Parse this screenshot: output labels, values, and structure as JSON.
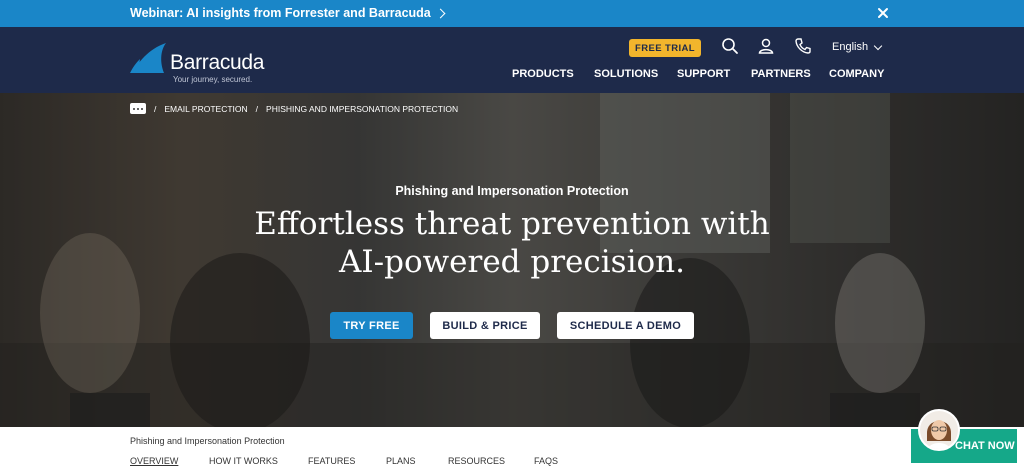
{
  "banner": {
    "text": "Webinar: AI insights from Forrester and Barracuda",
    "close_icon": "close-icon"
  },
  "header": {
    "logo": {
      "name": "Barracuda",
      "tagline": "Your journey, secured."
    },
    "free_trial": "FREE TRIAL",
    "icons": [
      "search-icon",
      "user-icon",
      "phone-icon"
    ],
    "language": "English",
    "nav": [
      "PRODUCTS",
      "SOLUTIONS",
      "SUPPORT",
      "PARTNERS",
      "COMPANY"
    ]
  },
  "breadcrumb": {
    "items": [
      "EMAIL PROTECTION",
      "PHISHING AND IMPERSONATION PROTECTION"
    ],
    "separator": "/"
  },
  "hero": {
    "eyebrow": "Phishing and Impersonation Protection",
    "headline_line1": "Effortless threat prevention with",
    "headline_line2": "AI-powered precision.",
    "buttons": {
      "try_free": "TRY FREE",
      "build_price": "BUILD & PRICE",
      "schedule_demo": "SCHEDULE A DEMO"
    }
  },
  "subnav": {
    "title": "Phishing and Impersonation Protection",
    "tabs": [
      "OVERVIEW",
      "HOW IT WORKS",
      "FEATURES",
      "PLANS",
      "RESOURCES",
      "FAQS"
    ]
  },
  "chat": {
    "label": "CHAT NOW"
  },
  "colors": {
    "brand_navy": "#1e2a4a",
    "brand_blue": "#1a86c8",
    "trial_yellow": "#f2b52c",
    "chat_green": "#15a889"
  }
}
